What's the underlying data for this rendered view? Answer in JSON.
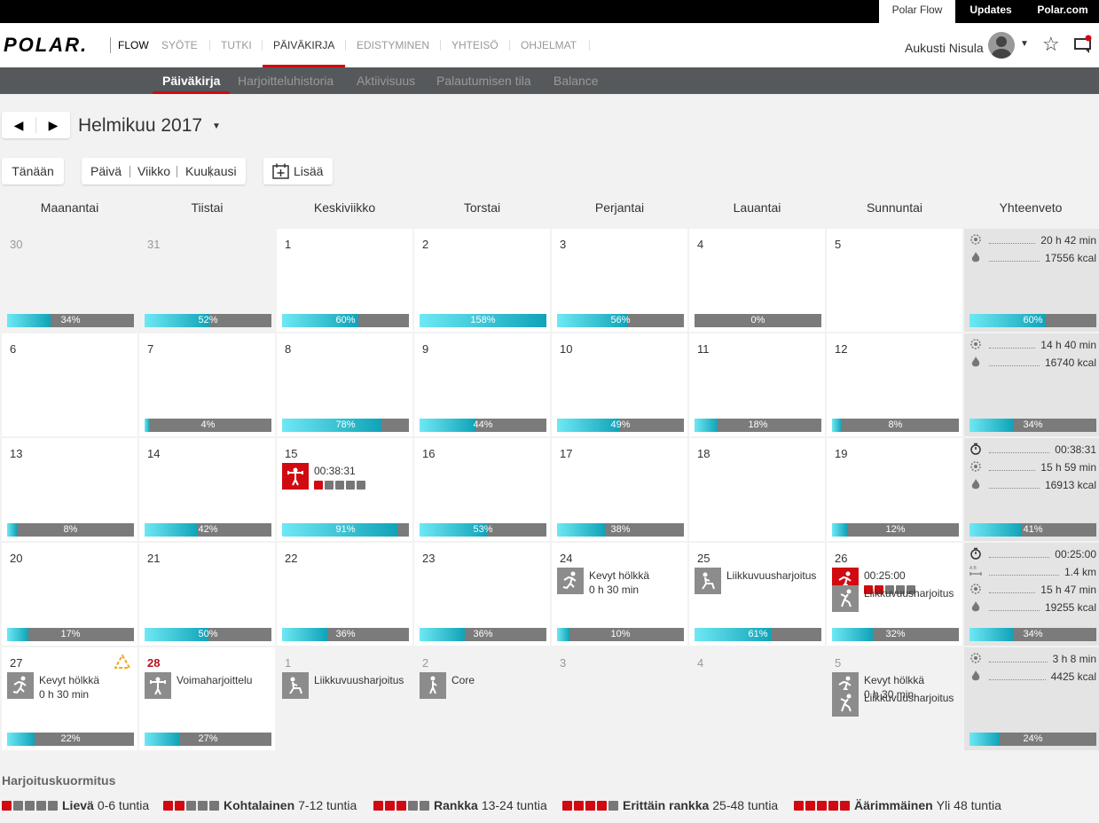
{
  "topbar": {
    "links": [
      "Polar Flow",
      "Updates",
      "Polar.com"
    ]
  },
  "nav": {
    "logo": "POLAR.",
    "items": [
      "FLOW",
      "SYÖTE",
      "TUTKI",
      "PÄIVÄKIRJA",
      "EDISTYMINEN",
      "YHTEISÖ",
      "OHJELMAT"
    ],
    "active": "PÄIVÄKIRJA",
    "user_name": "Aukusti Nisula"
  },
  "subnav": {
    "items": [
      "Päiväkirja",
      "Harjoitteluhistoria",
      "Aktiivisuus",
      "Palautumisen tila",
      "Balance"
    ],
    "active": "Päiväkirja"
  },
  "header": {
    "month": "Helmikuu 2017",
    "today": "Tänään",
    "views": [
      "Päivä",
      "Viikko",
      "Kuukausi"
    ],
    "add": "Lisää"
  },
  "calendar": {
    "weekdays": [
      "Maanantai",
      "Tiistai",
      "Keskiviikko",
      "Torstai",
      "Perjantai",
      "Lauantai",
      "Sunnuntai",
      "Yhteenveto"
    ],
    "weeks": [
      {
        "days": [
          {
            "n": "30",
            "other": true,
            "pct": 34
          },
          {
            "n": "31",
            "other": true,
            "pct": 52
          },
          {
            "n": "1",
            "pct": 60
          },
          {
            "n": "2",
            "pct": 158
          },
          {
            "n": "3",
            "pct": 56
          },
          {
            "n": "4",
            "pct": 0
          },
          {
            "n": "5",
            "pct": null
          }
        ],
        "summary": {
          "rows": [
            {
              "icon": "activity-icon",
              "value": "20 h 42 min"
            },
            {
              "icon": "calories-icon",
              "value": "17556 kcal"
            }
          ],
          "pct": 60
        }
      },
      {
        "days": [
          {
            "n": "6",
            "pct": null
          },
          {
            "n": "7",
            "pct": 4
          },
          {
            "n": "8",
            "pct": 78
          },
          {
            "n": "9",
            "pct": 44
          },
          {
            "n": "10",
            "pct": 49
          },
          {
            "n": "11",
            "pct": 18
          },
          {
            "n": "12",
            "pct": 8
          }
        ],
        "summary": {
          "rows": [
            {
              "icon": "activity-icon",
              "value": "14 h 40 min"
            },
            {
              "icon": "calories-icon",
              "value": "16740 kcal"
            }
          ],
          "pct": 34
        }
      },
      {
        "days": [
          {
            "n": "13",
            "pct": 8
          },
          {
            "n": "14",
            "pct": 42
          },
          {
            "n": "15",
            "pct": 91,
            "acts": [
              {
                "icon": "strength-training-icon",
                "red": true,
                "t1": "00:38:31",
                "load": 1
              }
            ]
          },
          {
            "n": "16",
            "pct": 53
          },
          {
            "n": "17",
            "pct": 38
          },
          {
            "n": "18",
            "pct": null
          },
          {
            "n": "19",
            "pct": 12
          }
        ],
        "summary": {
          "rows": [
            {
              "icon": "stopwatch-icon",
              "value": "00:38:31"
            },
            {
              "icon": "activity-icon",
              "value": "15 h 59 min"
            },
            {
              "icon": "calories-icon",
              "value": "16913 kcal"
            }
          ],
          "pct": 41
        }
      },
      {
        "days": [
          {
            "n": "20",
            "pct": 17
          },
          {
            "n": "21",
            "pct": 50
          },
          {
            "n": "22",
            "pct": 36
          },
          {
            "n": "23",
            "pct": 36
          },
          {
            "n": "24",
            "pct": 10,
            "acts": [
              {
                "icon": "running-icon",
                "t1": "Kevyt hölkkä",
                "t2": "0 h 30 min"
              }
            ]
          },
          {
            "n": "25",
            "pct": 61,
            "acts": [
              {
                "icon": "mobility-icon",
                "t1": "Liikkuvuusharjoitus"
              }
            ]
          },
          {
            "n": "26",
            "pct": 32,
            "acts": [
              {
                "icon": "running-icon",
                "red": true,
                "t1": "00:25:00",
                "load": 2
              },
              {
                "icon": "stretching-icon",
                "t1": "Liikkuvuusharjoitus"
              }
            ]
          }
        ],
        "summary": {
          "rows": [
            {
              "icon": "stopwatch-icon",
              "value": "00:25:00"
            },
            {
              "icon": "distance-icon",
              "value": "1.4 km"
            },
            {
              "icon": "activity-icon",
              "value": "15 h 47 min"
            },
            {
              "icon": "calories-icon",
              "value": "19255 kcal"
            }
          ],
          "pct": 34
        }
      },
      {
        "days": [
          {
            "n": "27",
            "pct": 22,
            "warn": true,
            "acts": [
              {
                "icon": "running-icon",
                "t1": "Kevyt hölkkä",
                "t2": "0 h 30 min"
              }
            ]
          },
          {
            "n": "28",
            "today": true,
            "pct": 27,
            "acts": [
              {
                "icon": "strength-training-icon",
                "t1": "Voimaharjoittelu"
              }
            ]
          },
          {
            "n": "1",
            "other": true,
            "pct": null,
            "acts": [
              {
                "icon": "mobility-icon",
                "t1": "Liikkuvuusharjoitus"
              }
            ]
          },
          {
            "n": "2",
            "other": true,
            "pct": null,
            "acts": [
              {
                "icon": "core-icon",
                "t1": "Core"
              }
            ]
          },
          {
            "n": "3",
            "other": true,
            "pct": null
          },
          {
            "n": "4",
            "other": true,
            "pct": null
          },
          {
            "n": "5",
            "other": true,
            "pct": null,
            "acts": [
              {
                "icon": "running-icon",
                "t1": "Kevyt hölkkä",
                "t2": "0 h 30 min"
              },
              {
                "icon": "stretching-icon",
                "t1": "Liikkuvuusharjoitus"
              }
            ]
          }
        ],
        "summary": {
          "rows": [
            {
              "icon": "activity-icon",
              "value": "3 h 8 min"
            },
            {
              "icon": "calories-icon",
              "value": "4425 kcal"
            }
          ],
          "pct": 24
        }
      }
    ]
  },
  "legend": {
    "title": "Harjoituskuormitus",
    "items": [
      {
        "level": 1,
        "name": "Lievä",
        "range": "0-6 tuntia"
      },
      {
        "level": 2,
        "name": "Kohtalainen",
        "range": "7-12 tuntia"
      },
      {
        "level": 3,
        "name": "Rankka",
        "range": "13-24 tuntia"
      },
      {
        "level": 4,
        "name": "Erittäin rankka",
        "range": "25-48 tuntia"
      },
      {
        "level": 5,
        "name": "Äärimmäinen",
        "range": "Yli 48 tuntia"
      }
    ]
  },
  "colors": {
    "accent": "#d10a11",
    "bar_fill_start": "#6ee8f4",
    "bar_fill_end": "#10a3b8",
    "bar_bg": "#7b7b7b",
    "subnav_bg": "#55595c"
  }
}
